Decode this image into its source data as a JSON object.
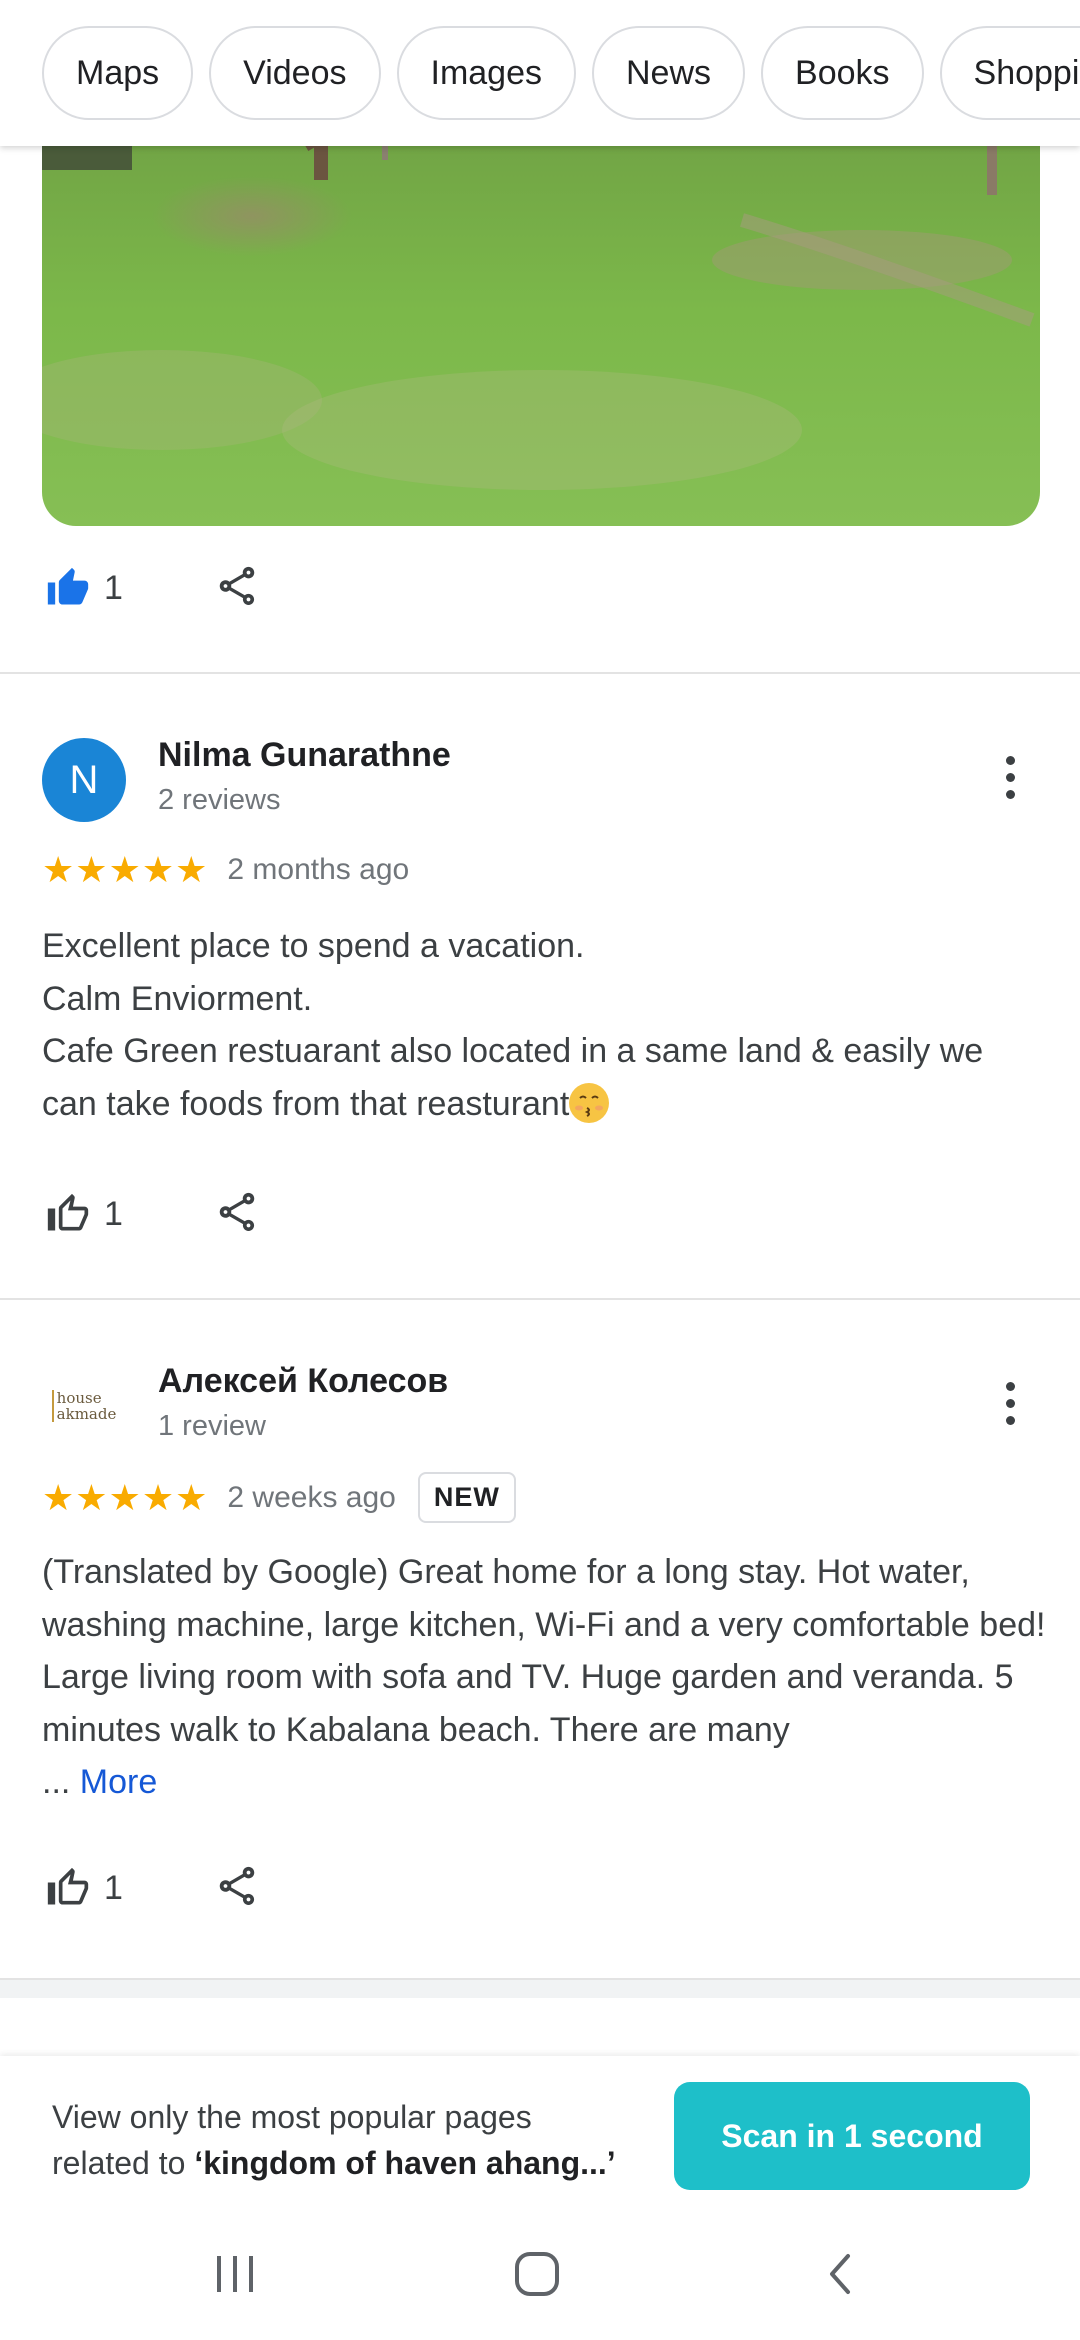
{
  "chips": [
    "Maps",
    "Videos",
    "Images",
    "News",
    "Books",
    "Shopping"
  ],
  "first_review_actions": {
    "like_count": "1"
  },
  "reviews": [
    {
      "avatar_letter": "N",
      "author": "Nilma Gunarathne",
      "reviews_count": "2 reviews",
      "rating": 5,
      "time": "2 months ago",
      "lines": [
        "Excellent place to spend a vacation.",
        "Calm Enviorment.",
        "Cafe Green restuarant also located in a same land & easily we can take foods from that reasturant"
      ],
      "like_count": "1"
    },
    {
      "avatar_logo_text": [
        "house",
        "akmade"
      ],
      "author": "Алексей Колесов",
      "reviews_count": "1 review",
      "rating": 5,
      "time": "2 weeks ago",
      "badge": "NEW",
      "text": "(Translated by Google) Great home for a long stay. Hot water, washing machine, large kitchen, Wi-Fi and a very comfortable bed! Large living room with sofa and TV. Huge garden and veranda. 5 minutes walk to Kabalana beach. There are many",
      "more_prefix": "...",
      "more_label": "More",
      "like_count": "1"
    }
  ],
  "promo": {
    "line1": "View only the most popular pages",
    "line2_prefix": "related to ",
    "line2_query": "‘kingdom of haven ahang...’",
    "button": "Scan in 1 second"
  },
  "colors": {
    "star": "#f9ab00",
    "accent_blue": "#1a73e8",
    "scan_button": "#1ebfc9",
    "avatar": "#1a85d6"
  },
  "icons": [
    "thumbs-up-filled-icon",
    "share-icon",
    "thumbs-up-outline-icon",
    "more-vert-icon",
    "recents-icon",
    "home-icon",
    "back-icon"
  ]
}
